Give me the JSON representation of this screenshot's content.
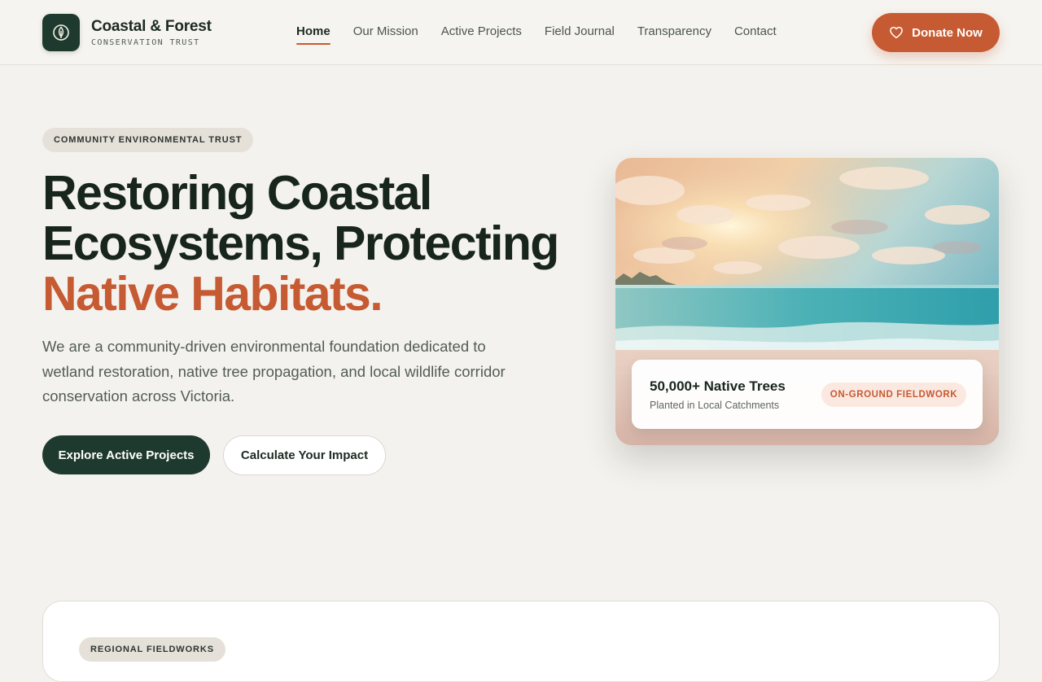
{
  "brand": {
    "name": "Coastal & Forest",
    "subtitle": "CONSERVATION TRUST",
    "logo_icon": "leaf-flame-icon"
  },
  "nav": {
    "items": [
      {
        "label": "Home",
        "active": true
      },
      {
        "label": "Our Mission",
        "active": false
      },
      {
        "label": "Active Projects",
        "active": false
      },
      {
        "label": "Field Journal",
        "active": false
      },
      {
        "label": "Transparency",
        "active": false
      },
      {
        "label": "Contact",
        "active": false
      }
    ]
  },
  "donate": {
    "label": "Donate Now",
    "icon": "heart-icon"
  },
  "hero": {
    "eyebrow": "COMMUNITY ENVIRONMENTAL TRUST",
    "headline_line1": "Restoring Coastal",
    "headline_line2": "Ecosystems, Protecting",
    "headline_accent": "Native Habitats.",
    "lede": "We are a community-driven environmental foundation dedicated to wetland restoration, native tree propagation, and local wildlife corridor conservation across Victoria.",
    "cta_primary": "Explore Active Projects",
    "cta_secondary": "Calculate Your Impact"
  },
  "hero_card": {
    "stat_title": "50,000+ Native Trees",
    "stat_subtitle": "Planted in Local Catchments",
    "badge": "ON-GROUND FIELDWORK"
  },
  "section2": {
    "eyebrow": "REGIONAL FIELDWORKS"
  },
  "colors": {
    "background": "#f4f2ee",
    "primary_dark": "#1e3a2e",
    "accent": "#c65a32",
    "badge_bg": "#fbe9e1"
  }
}
